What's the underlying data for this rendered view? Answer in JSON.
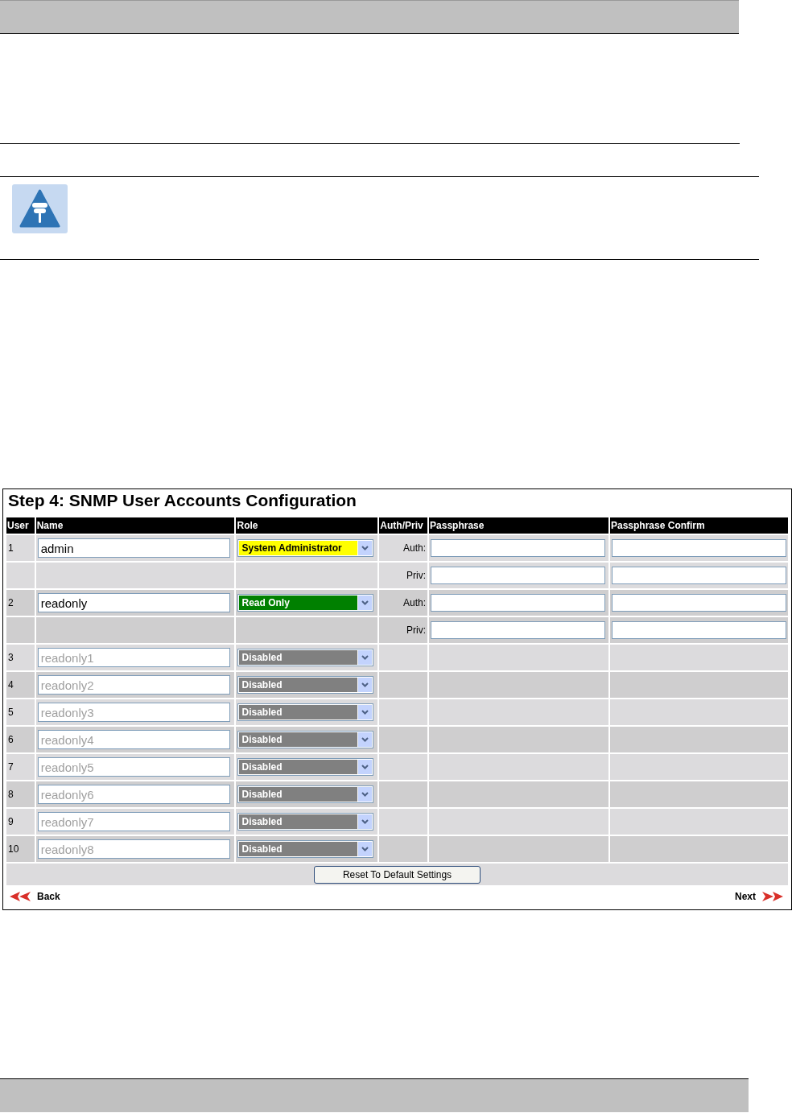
{
  "screen": {
    "title": "Step 4: SNMP User Accounts Configuration",
    "columns": [
      "User",
      "Name",
      "Role",
      "Auth/Priv",
      "Passphrase",
      "Passphrase Confirm"
    ],
    "users": [
      {
        "number": "1",
        "name": "admin",
        "disabled": false,
        "role": "System Administrator",
        "color": "#ffff00",
        "keys": [
          "Auth:",
          "Priv:"
        ]
      },
      {
        "number": "2",
        "name": "readonly",
        "disabled": false,
        "role": "Read Only",
        "color": "#008000",
        "keys": [
          "Auth:",
          "Priv:"
        ]
      },
      {
        "number": "3",
        "name": "readonly1",
        "disabled": true,
        "role": "Disabled",
        "color": "#808080"
      },
      {
        "number": "4",
        "name": "readonly2",
        "disabled": true,
        "role": "Disabled",
        "color": "#808080"
      },
      {
        "number": "5",
        "name": "readonly3",
        "disabled": true,
        "role": "Disabled",
        "color": "#808080"
      },
      {
        "number": "6",
        "name": "readonly4",
        "disabled": true,
        "role": "Disabled",
        "color": "#808080"
      },
      {
        "number": "7",
        "name": "readonly5",
        "disabled": true,
        "role": "Disabled",
        "color": "#808080"
      },
      {
        "number": "8",
        "name": "readonly6",
        "disabled": true,
        "role": "Disabled",
        "color": "#808080"
      },
      {
        "number": "9",
        "name": "readonly7",
        "disabled": true,
        "role": "Disabled",
        "color": "#808080"
      },
      {
        "number": "10",
        "name": "readonly8",
        "disabled": true,
        "role": "Disabled",
        "color": "#808080"
      }
    ],
    "reset_button": "Reset To Default Settings",
    "back": "Back",
    "next": "Next"
  }
}
